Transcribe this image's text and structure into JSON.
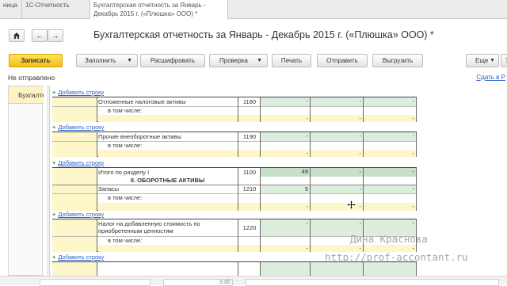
{
  "tabs": [
    "ница",
    "1С-Отчетность",
    "Бухгалтерская отчетность за Январь - Декабрь 2015 г. («Плюшка» ООО) *"
  ],
  "nav": {
    "home_icon": "home-icon",
    "back": "←",
    "forward": "→"
  },
  "page_title": "Бухгалтерская отчетность за Январь - Декабрь 2015 г. («Плюшка» ООО) *",
  "toolbar": {
    "save": "Записать",
    "fill": "Заполнить",
    "decode": "Расшифровать",
    "check": "Проверка",
    "print": "Печать",
    "send": "Отправить",
    "upload": "Выгрузить",
    "more": "Еще",
    "help": "?"
  },
  "status": "Не отправлено",
  "save_link": "Сдать в Р",
  "section_tab": "Бухгалтерский баланс",
  "add_row_label": "Добавить строку",
  "rows": [
    {
      "name": "Отложенные налоговые активы",
      "code": "1180",
      "sub": "в том числе:",
      "v1": "-",
      "v2": "-",
      "v3": "-",
      "s1": "-",
      "s2": "-",
      "s3": "-"
    },
    {
      "name": "Прочие внеоборотные активы",
      "code": "1190",
      "sub": "в том числе:",
      "v1": "-",
      "v2": "-",
      "v3": "-",
      "s1": "-",
      "s2": "-",
      "s3": "-"
    },
    {
      "name": "Итого по разделу I",
      "code": "1100",
      "v1": "49",
      "v2": "-",
      "v3": "-",
      "section": "II. ОБОРОТНЫЕ АКТИВЫ",
      "name2": "Запасы",
      "code2": "1210",
      "w1": "5",
      "w2": "-",
      "w3": "-",
      "sub": "в том числе:",
      "s1": "-",
      "s2": "-",
      "s3": "-"
    },
    {
      "name": "Налог на добавленную стоимость по приобретенным ценностям",
      "code": "1220",
      "sub": "в том числе:",
      "v1": "-",
      "v2": "-",
      "v3": "-",
      "s1": "-",
      "s2": "-",
      "s3": "-"
    }
  ],
  "watermark": {
    "line1": "Дина Краснова",
    "line2": "http://prof-accontant.ru"
  },
  "bottom_value": "0.00"
}
